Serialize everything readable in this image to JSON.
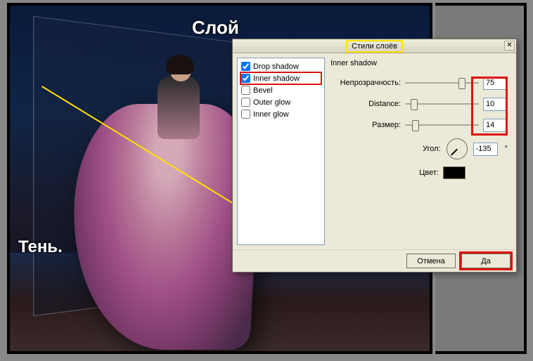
{
  "overlay": {
    "layer_label": "Слой",
    "shadow_label": "Тень."
  },
  "dialog": {
    "title": "Стили слоёв",
    "close": "✕",
    "effects": {
      "drop_shadow": {
        "label": "Drop shadow",
        "checked": true
      },
      "inner_shadow": {
        "label": "Inner shadow",
        "checked": true
      },
      "bevel": {
        "label": "Bevel",
        "checked": false
      },
      "outer_glow": {
        "label": "Outer glow",
        "checked": false
      },
      "inner_glow": {
        "label": "Inner glow",
        "checked": false
      }
    },
    "panel_title": "Inner shadow",
    "params": {
      "opacity": {
        "label": "Непрозрачность:",
        "value": "75"
      },
      "distance": {
        "label": "Distance:",
        "value": "10"
      },
      "size": {
        "label": "Размер:",
        "value": "14"
      },
      "angle": {
        "label": "Угол:",
        "value": "-135",
        "deg": "°"
      },
      "color": {
        "label": "Цвет:",
        "value": "#000000"
      }
    },
    "buttons": {
      "cancel": "Отмена",
      "ok": "Да"
    }
  }
}
